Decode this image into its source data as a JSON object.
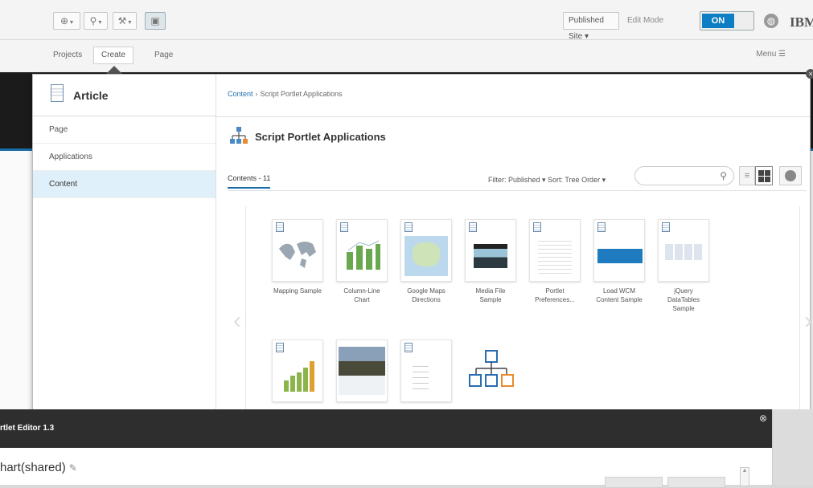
{
  "toolbar": {
    "published_site": "Published Site ▾",
    "edit_mode_label": "Edit Mode",
    "edit_mode_state": "ON",
    "brand": "IBM"
  },
  "nav": {
    "projects": "Projects",
    "create": "Create",
    "page": "Page",
    "menu": "Menu ☰"
  },
  "panel": {
    "heading": "Article",
    "left_items": [
      "Page",
      "Applications",
      "Content"
    ],
    "breadcrumb_root": "Content",
    "breadcrumb_current": "Script Portlet Applications",
    "section_title": "Script Portlet Applications",
    "contents_tab": "Contents - 11",
    "filter_text": "Filter: Published ▾   Sort: Tree Order ▾",
    "search_placeholder": "",
    "tiles": [
      {
        "label": "Mapping Sample",
        "icon": "world-map-thumbnail"
      },
      {
        "label": "Column-Line Chart",
        "icon": "bar-chart-thumbnail"
      },
      {
        "label": "Google Maps Directions",
        "icon": "map-thumbnail"
      },
      {
        "label": "Media File Sample",
        "icon": "media-thumbnail"
      },
      {
        "label": "Portlet Preferences...",
        "icon": "preferences-thumbnail"
      },
      {
        "label": "Load WCM Content Sample",
        "icon": "wcm-thumbnail"
      },
      {
        "label": "jQuery DataTables Sample",
        "icon": "datatable-thumbnail"
      },
      {
        "label": "",
        "icon": "chart-thumbnail"
      },
      {
        "label": "",
        "icon": "photo-thumbnail"
      },
      {
        "label": "",
        "icon": "list-thumbnail"
      },
      {
        "label": "",
        "icon": "hierarchy-thumbnail"
      }
    ]
  },
  "editor": {
    "title": "rtlet Editor 1.3",
    "app_name": "hart(shared)"
  }
}
